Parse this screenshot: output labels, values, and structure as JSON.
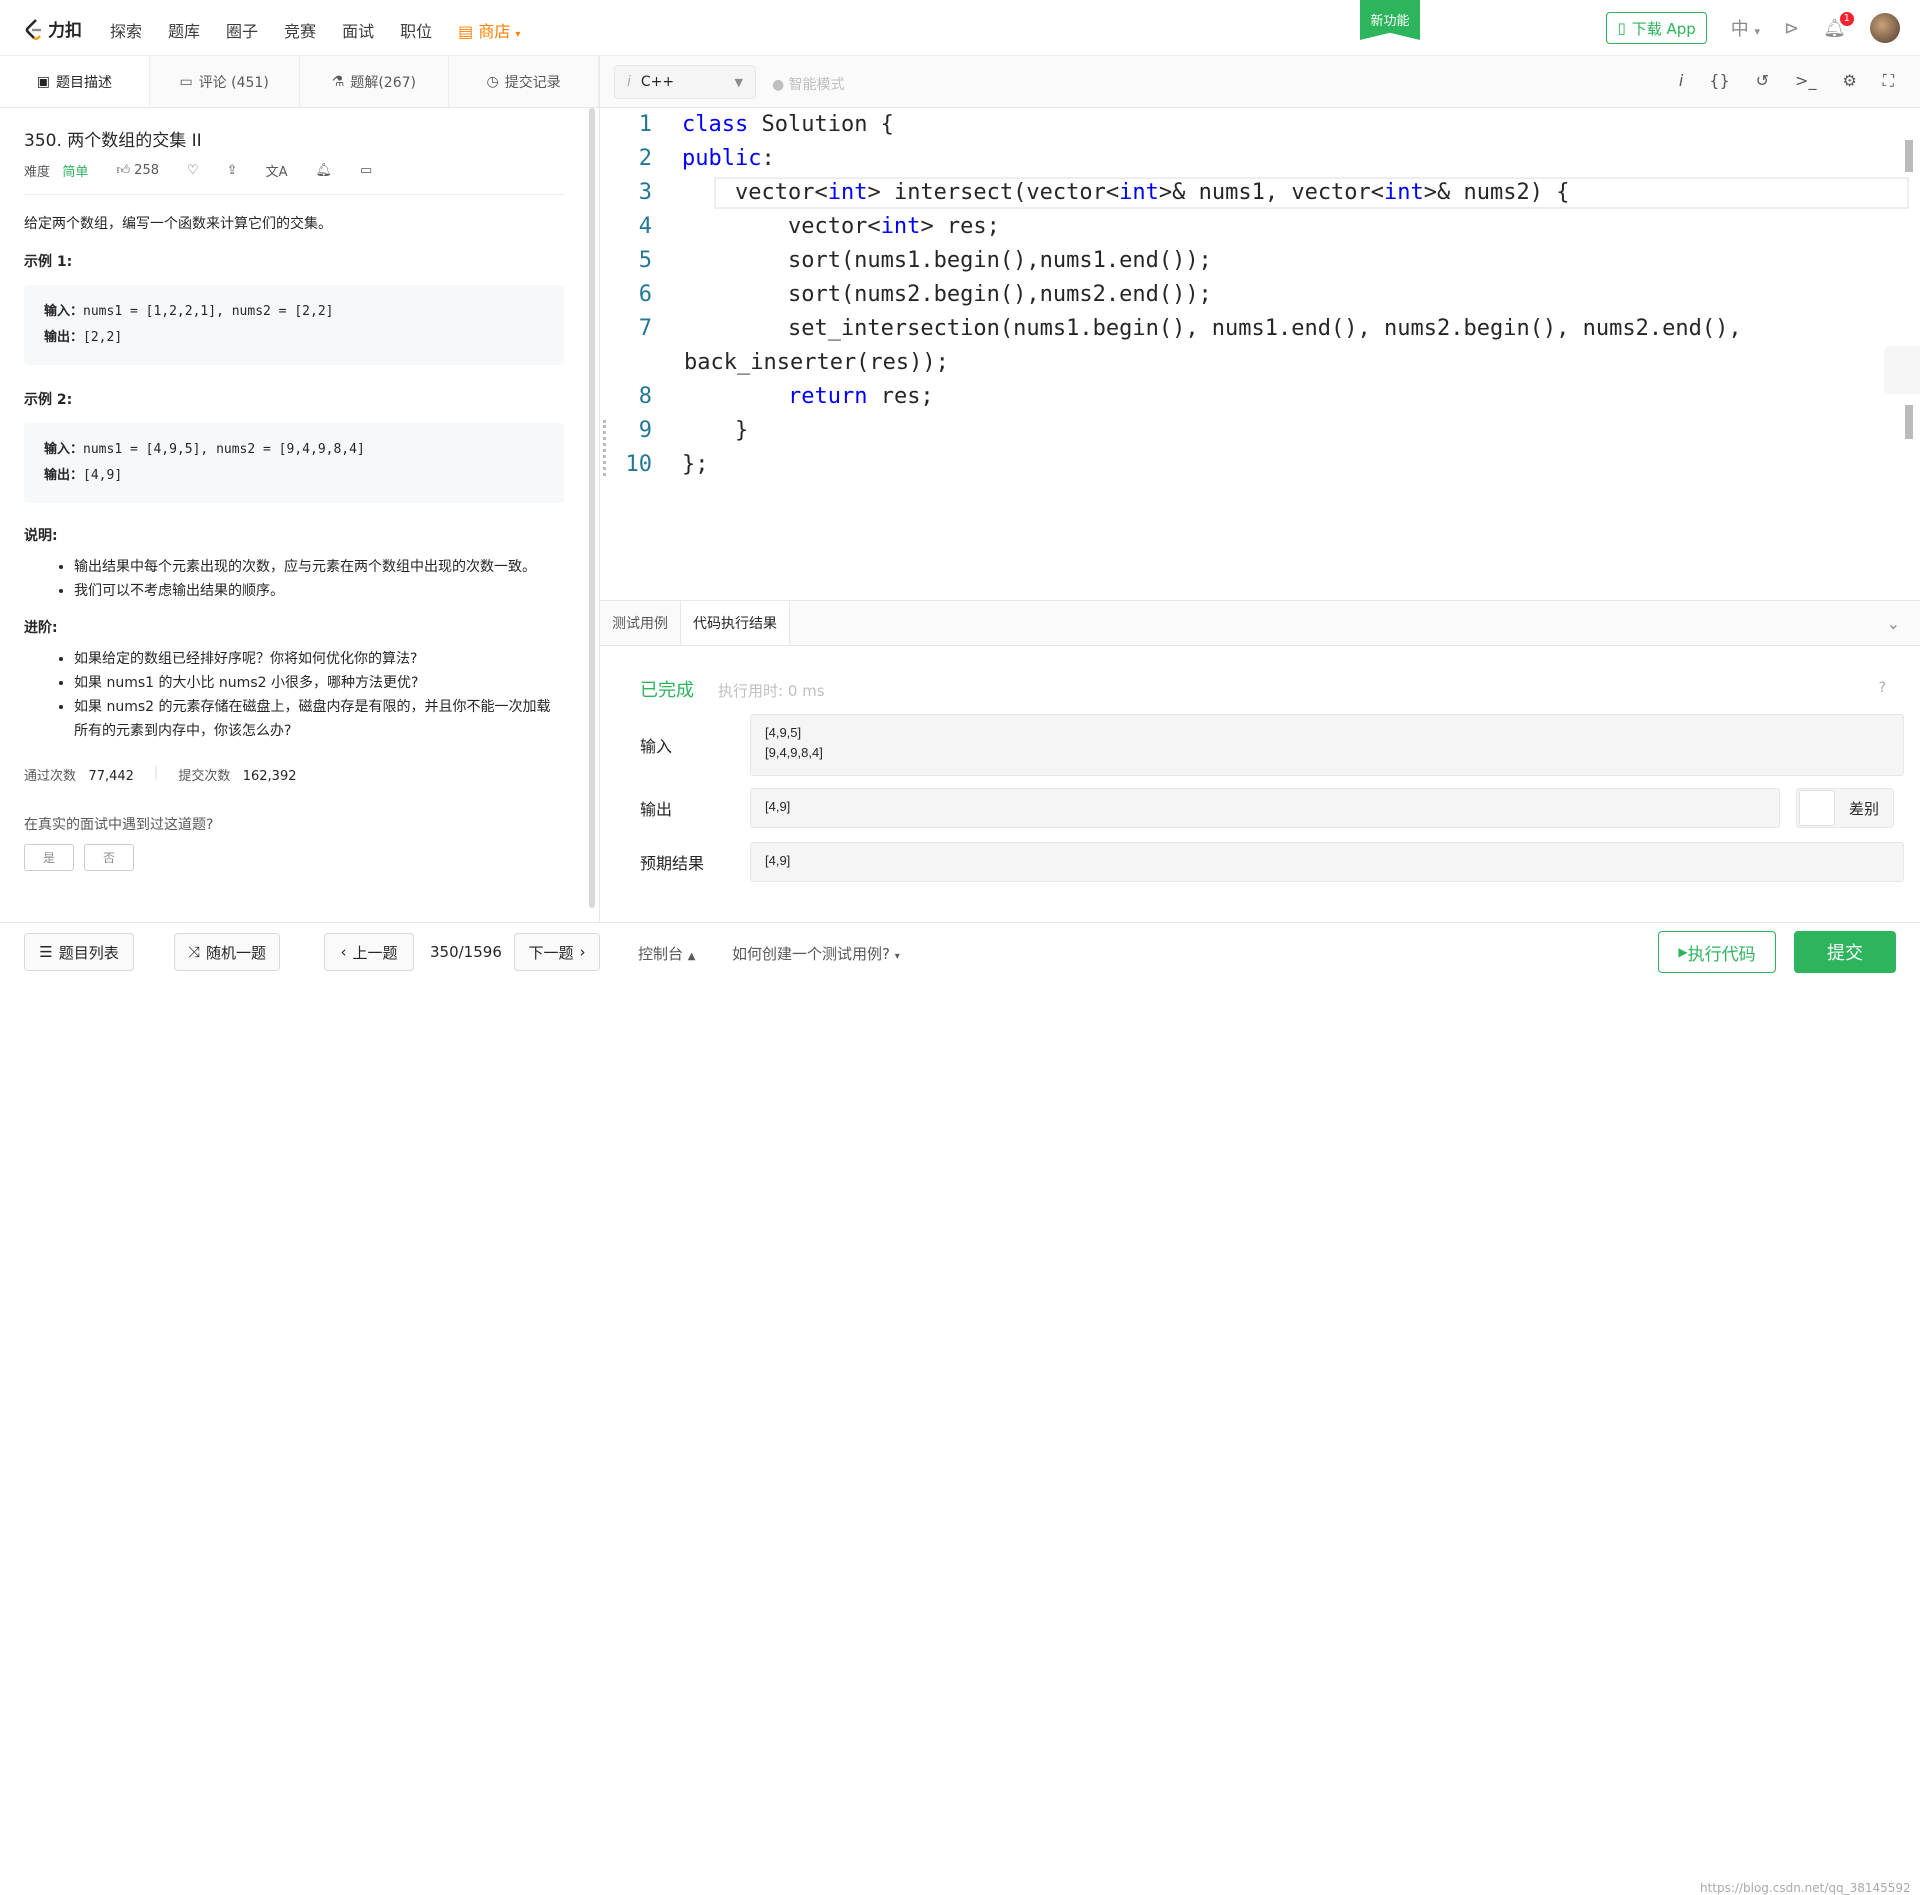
{
  "nav": {
    "logo_text": "力扣",
    "items": [
      "探索",
      "题库",
      "圈子",
      "竞赛",
      "面试",
      "职位"
    ],
    "store": "商店",
    "new_feature": "新功能",
    "download_app": "下载 App",
    "language": "中",
    "notification_count": "1"
  },
  "left_tabs": [
    {
      "label": "题目描述",
      "icon": "description-icon"
    },
    {
      "label": "评论 (451)",
      "icon": "comment-icon"
    },
    {
      "label": "题解(267)",
      "icon": "flask-icon"
    },
    {
      "label": "提交记录",
      "icon": "clock-icon"
    }
  ],
  "problem": {
    "title": "350. 两个数组的交集 II",
    "difficulty_label": "难度",
    "difficulty": "简单",
    "likes": "258",
    "description": "给定两个数组，编写一个函数来计算它们的交集。",
    "example1_title": "示例 1:",
    "example1_input_label": "输入：",
    "example1_input": "nums1 = [1,2,2,1], nums2 = [2,2]",
    "example1_output_label": "输出：",
    "example1_output": "[2,2]",
    "example2_title": "示例 2:",
    "example2_input_label": "输入：",
    "example2_input": "nums1 = [4,9,5], nums2 = [9,4,9,8,4]",
    "example2_output_label": "输出：",
    "example2_output": "[4,9]",
    "notes_title": "说明:",
    "notes": [
      "输出结果中每个元素出现的次数，应与元素在两个数组中出现的次数一致。",
      "我们可以不考虑输出结果的顺序。"
    ],
    "advanced_title": "进阶:",
    "advanced": [
      "如果给定的数组已经排好序呢？你将如何优化你的算法?",
      "如果 nums1 的大小比 nums2 小很多，哪种方法更优?",
      "如果 nums2 的元素存储在磁盘上，磁盘内存是有限的，并且你不能一次加载所有的元素到内存中，你该怎么办?"
    ],
    "accepted_label": "通过次数",
    "accepted": "77,442",
    "submitted_label": "提交次数",
    "submitted": "162,392",
    "interview_question": "在真实的面试中遇到过这道题?",
    "yes": "是",
    "no": "否"
  },
  "editor": {
    "language": "C++",
    "smart_mode": "智能模式",
    "code_lines": [
      {
        "n": "1",
        "html": "<span class='kw'>class</span> Solution {"
      },
      {
        "n": "2",
        "html": "<span class='kw'>public</span>:"
      },
      {
        "n": "3",
        "html": "    vector&lt;<span class='kw'>int</span>&gt; intersect(vector&lt;<span class='kw'>int</span>&gt;&amp; nums1, vector&lt;<span class='kw'>int</span>&gt;&amp; nums2) {"
      },
      {
        "n": "4",
        "html": "        vector&lt;<span class='kw'>int</span>&gt; res;"
      },
      {
        "n": "5",
        "html": "        sort(nums1.begin(),nums1.end());"
      },
      {
        "n": "6",
        "html": "        sort(nums2.begin(),nums2.end());"
      },
      {
        "n": "7",
        "html": "        set_intersection(nums1.begin(), nums1.end(), nums2.begin(), nums2.end(),"
      },
      {
        "n": "",
        "html": "back_inserter(res));"
      },
      {
        "n": "8",
        "html": "        <span class='kw'>return</span> res;"
      },
      {
        "n": "9",
        "html": "    }"
      },
      {
        "n": "10",
        "html": "};"
      }
    ]
  },
  "result": {
    "tab_testcase": "测试用例",
    "tab_result": "代码执行结果",
    "status": "已完成",
    "runtime": "执行用时: 0 ms",
    "input_label": "输入",
    "input_line1": "[4,9,5]",
    "input_line2": "[9,4,9,8,4]",
    "output_label": "输出",
    "output": "[4,9]",
    "diff_label": "差别",
    "expected_label": "预期结果",
    "expected": "[4,9]"
  },
  "bottom": {
    "problem_list": "题目列表",
    "random": "随机一题",
    "prev": "上一题",
    "page": "350/1596",
    "next": "下一题",
    "console": "控制台",
    "howto": "如何创建一个测试用例?",
    "run": "执行代码",
    "submit": "提交",
    "watermark": "https://blog.csdn.net/qq_38145592"
  },
  "colors": {
    "brand_green": "#2db55d",
    "store_orange": "#ff8000",
    "keyword_blue": "#0000ff"
  }
}
